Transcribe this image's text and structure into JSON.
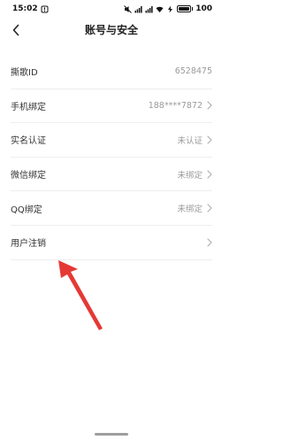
{
  "status_bar": {
    "time": "15:02",
    "battery": "100",
    "accent": "#111111"
  },
  "nav": {
    "title": "账号与安全",
    "back_icon": "back-chevron-icon"
  },
  "rows": [
    {
      "label": "撕歌ID",
      "value": "6528475",
      "has_chevron": false
    },
    {
      "label": "手机绑定",
      "value": "188****7872",
      "has_chevron": true
    },
    {
      "label": "实名认证",
      "value": "未认证",
      "has_chevron": true
    },
    {
      "label": "微信绑定",
      "value": "未绑定",
      "has_chevron": true
    },
    {
      "label": "QQ绑定",
      "value": "未绑定",
      "has_chevron": true
    },
    {
      "label": "用户注销",
      "value": "",
      "has_chevron": true
    }
  ],
  "colors": {
    "arrow": "#e53935",
    "divider": "#eeeeee",
    "secondary_text": "#9a9a9a"
  }
}
